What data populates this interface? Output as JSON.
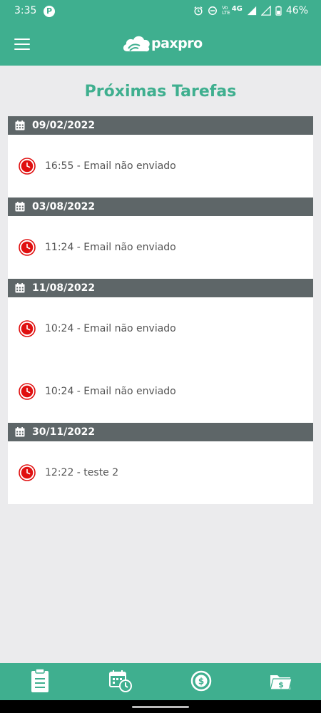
{
  "status": {
    "time": "3:35",
    "network_top": "Vo",
    "network_bottom": "LTE",
    "network_type": "4G",
    "battery": "46%"
  },
  "app": {
    "logo_text": "paxpro"
  },
  "page": {
    "title": "Próximas Tarefas"
  },
  "groups": [
    {
      "date": "09/02/2022",
      "tasks": [
        {
          "text": "16:55 - Email não enviado"
        }
      ]
    },
    {
      "date": "03/08/2022",
      "tasks": [
        {
          "text": "11:24 - Email não enviado"
        }
      ]
    },
    {
      "date": "11/08/2022",
      "tasks": [
        {
          "text": "10:24 - Email não enviado"
        },
        {
          "text": "10:24 - Email não enviado"
        }
      ]
    },
    {
      "date": "30/11/2022",
      "tasks": [
        {
          "text": "12:22 - teste 2"
        }
      ]
    }
  ],
  "colors": {
    "primary": "#3faf8f",
    "header_gray": "#5e6668",
    "alarm_red": "#e01010",
    "background": "#ebebed"
  },
  "icons": {
    "menu": "hamburger-menu-icon",
    "date": "calendar-icon",
    "task": "alarm-clock-icon",
    "nav": [
      "clipboard-icon",
      "calendar-clock-icon",
      "dollar-coin-icon",
      "money-folder-icon"
    ]
  }
}
